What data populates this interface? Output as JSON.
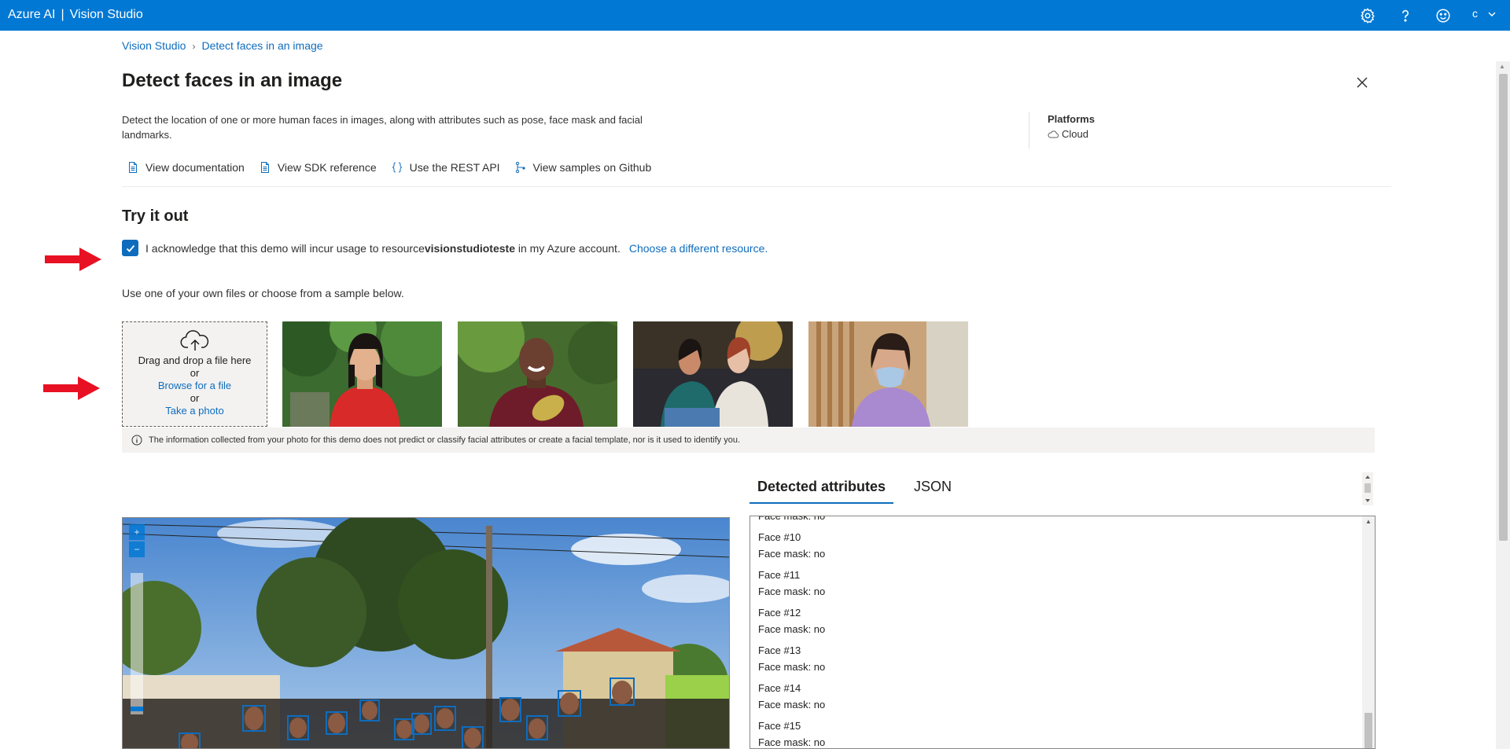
{
  "topbar": {
    "brand": "Azure AI",
    "separator": "|",
    "product": "Vision Studio",
    "user_initial": "c",
    "color": "#0078d4"
  },
  "breadcrumb": {
    "root": "Vision Studio",
    "current": "Detect faces in an image"
  },
  "page": {
    "title": "Detect faces in an image",
    "description": "Detect the location of one or more human faces in images, along with attributes such as pose, face mask and facial landmarks.",
    "platforms_label": "Platforms",
    "platform_value": "Cloud"
  },
  "doc_links": [
    {
      "label": "View documentation",
      "icon": "document-icon"
    },
    {
      "label": "View SDK reference",
      "icon": "document-icon"
    },
    {
      "label": "Use the REST API",
      "icon": "braces-icon"
    },
    {
      "label": "View samples on Github",
      "icon": "branch-icon"
    }
  ],
  "try_it": {
    "heading": "Try it out",
    "ack_prefix": "I acknowledge that this demo will incur usage to resource ",
    "ack_resource": "visionstudioteste",
    "ack_suffix": " in my Azure account.",
    "choose_resource": "Choose a different resource.",
    "checked": true,
    "use_own": "Use one of your own files or choose from a sample below."
  },
  "dropzone": {
    "drag": "Drag and drop a file here",
    "or1": "or",
    "browse": "Browse for a file",
    "or2": "or",
    "take_photo": "Take a photo"
  },
  "info_bar": "The information collected from your photo for this demo does not predict or classify facial attributes or create a facial template, nor is it used to identify you.",
  "tabs": [
    {
      "label": "Detected attributes",
      "active": true
    },
    {
      "label": "JSON",
      "active": false
    }
  ],
  "results": {
    "partial_top": "Face mask: no",
    "faces": [
      {
        "title": "Face #10",
        "mask": "Face mask: no"
      },
      {
        "title": "Face #11",
        "mask": "Face mask: no"
      },
      {
        "title": "Face #12",
        "mask": "Face mask: no"
      },
      {
        "title": "Face #13",
        "mask": "Face mask: no"
      },
      {
        "title": "Face #14",
        "mask": "Face mask: no"
      },
      {
        "title": "Face #15",
        "mask": "Face mask: no"
      }
    ]
  }
}
